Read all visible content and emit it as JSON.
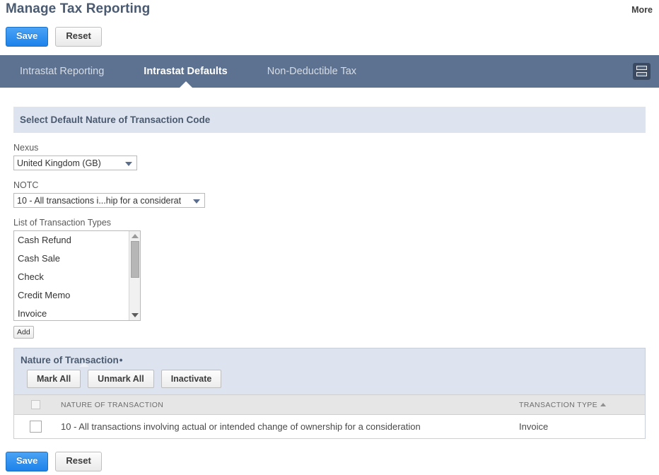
{
  "header": {
    "title": "Manage Tax Reporting",
    "more_label": "More"
  },
  "toolbar_top": {
    "save_label": "Save",
    "reset_label": "Reset"
  },
  "toolbar_bottom": {
    "save_label": "Save",
    "reset_label": "Reset"
  },
  "tabs": [
    {
      "label": "Intrastat Reporting",
      "active": false
    },
    {
      "label": "Intrastat Defaults",
      "active": true
    },
    {
      "label": "Non-Deductible Tax",
      "active": false
    }
  ],
  "tabstrip": {
    "menu_icon": "list-view-icon"
  },
  "panel": {
    "header": "Select Default Nature of Transaction Code",
    "fields": {
      "nexus": {
        "label": "Nexus",
        "value": "United Kingdom (GB)"
      },
      "notc": {
        "label": "NOTC",
        "value": "10 - All transactions i...hip for a considerat"
      },
      "transaction_types": {
        "label": "List of Transaction Types",
        "items": [
          "Cash Refund",
          "Cash Sale",
          "Check",
          "Credit Memo",
          "Invoice"
        ]
      }
    },
    "add_label": "Add"
  },
  "sublist": {
    "title": "Nature of Transaction",
    "title_dot": "•",
    "buttons": {
      "mark_all": "Mark All",
      "unmark_all": "Unmark All",
      "inactivate": "Inactivate"
    },
    "columns": [
      "",
      "NATURE OF TRANSACTION",
      "TRANSACTION TYPE"
    ],
    "sort_column": "TRANSACTION TYPE",
    "sort_direction": "ascending",
    "rows": [
      {
        "checked": false,
        "nature_of_transaction": "10 - All transactions involving actual or intended change of ownership for a consideration",
        "transaction_type": "Invoice"
      }
    ]
  },
  "colors": {
    "accent_blue": "#2a8ff0",
    "tabstrip": "#5d7290",
    "panel_header": "#dde4ef",
    "title_text": "#4a5a70"
  }
}
